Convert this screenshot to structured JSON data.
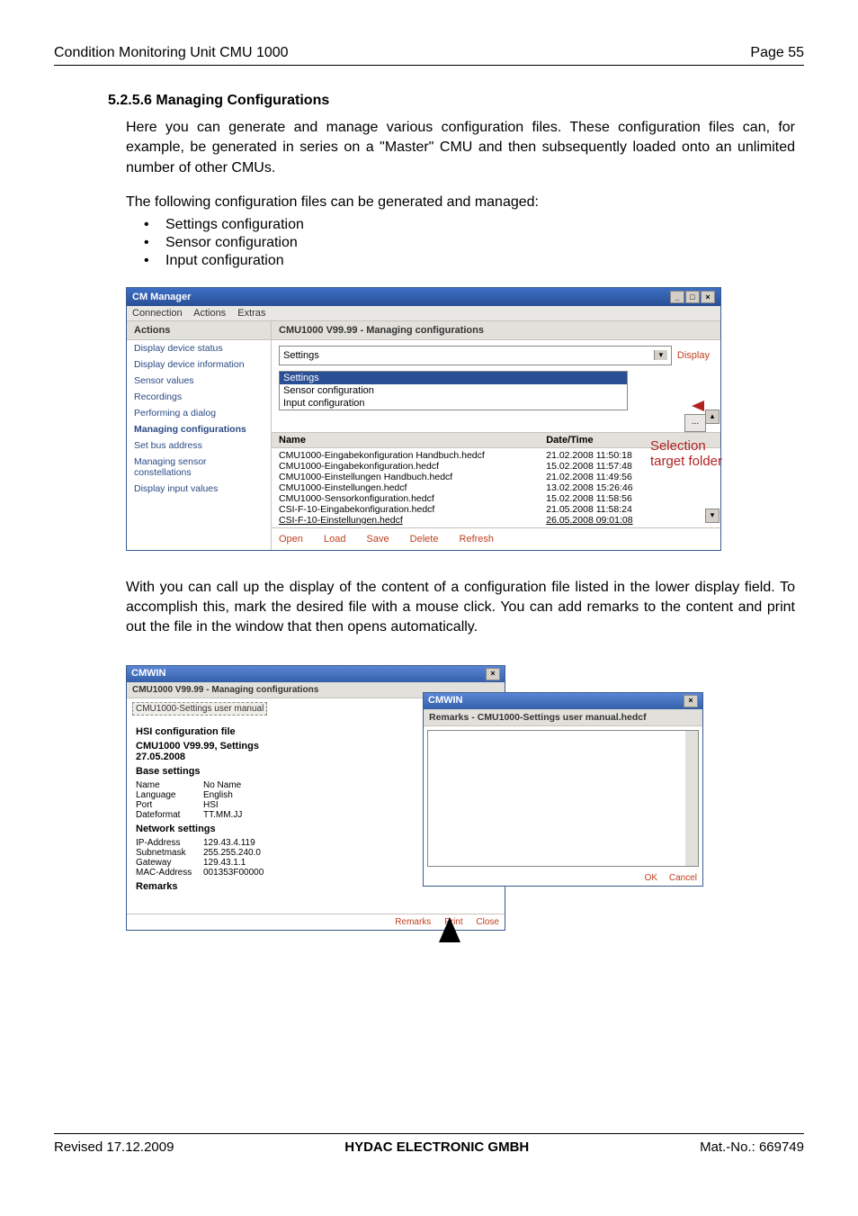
{
  "header": {
    "left": "Condition Monitoring Unit CMU 1000",
    "right": "Page 55"
  },
  "section": {
    "number_title": "5.2.5.6  Managing Configurations",
    "para1": "Here you can generate and manage various configuration files. These configuration files can, for example, be generated in series on a \"Master\" CMU and then subsequently loaded onto an unlimited number of other CMUs.",
    "para2": "The following configuration files can be generated and managed:",
    "bullets": [
      "Settings configuration",
      "Sensor configuration",
      "Input configuration"
    ]
  },
  "cm": {
    "title": "CM Manager",
    "menu": [
      "Connection",
      "Actions",
      "Extras"
    ],
    "side_head": "Actions",
    "side_items": [
      {
        "label": "Display device status",
        "bold": false
      },
      {
        "label": "Display device information",
        "bold": false
      },
      {
        "label": "Sensor values",
        "bold": false
      },
      {
        "label": "Recordings",
        "bold": false
      },
      {
        "label": "Performing a dialog",
        "bold": false
      },
      {
        "label": "Managing configurations",
        "bold": true
      },
      {
        "label": "Set bus address",
        "bold": false
      },
      {
        "label": "Managing sensor constellations",
        "bold": false
      },
      {
        "label": "Display input values",
        "bold": false
      }
    ],
    "main_head": "CMU1000 V99.99 - Managing configurations",
    "dropdown_value": "Settings",
    "display_btn": "Display",
    "dropdown_items": [
      "Settings",
      "Settings",
      "Sensor configuration",
      "Input configuration"
    ],
    "browse": "...",
    "col_name": "Name",
    "col_date": "Date/Time",
    "files": [
      {
        "name": "CMU1000-Eingabekonfiguration Handbuch.hedcf",
        "dt": "21.02.2008 11:50:18"
      },
      {
        "name": "CMU1000-Eingabekonfiguration.hedcf",
        "dt": "15.02.2008 11:57:48"
      },
      {
        "name": "CMU1000-Einstellungen Handbuch.hedcf",
        "dt": "21.02.2008 11:49:56"
      },
      {
        "name": "CMU1000-Einstellungen.hedcf",
        "dt": "13.02.2008 15:26:46"
      },
      {
        "name": "CMU1000-Sensorkonfiguration.hedcf",
        "dt": "15.02.2008 11:58:56"
      },
      {
        "name": "CSI-F-10-Eingabekonfiguration.hedcf",
        "dt": "21.05.2008 11:58:24"
      },
      {
        "name": "CSI-F-10-Einstellungen.hedcf",
        "dt": "26.05.2008 09:01:08"
      }
    ],
    "actions": [
      "Open",
      "Load",
      "Save",
      "Delete",
      "Refresh"
    ],
    "annot1": "Selection",
    "annot2": "target folder"
  },
  "para3": "With          you can call up the display of the content of a configuration file listed in the lower display field. To accomplish this, mark the desired file with a mouse click. You can add remarks to the content and print out the file in the window that then opens automatically.",
  "cmwin1": {
    "title": "CMWIN",
    "header": "CMU1000 V99.99 - Managing configurations",
    "tab": "CMU1000-Settings user manual",
    "h1": "HSI configuration file",
    "h2a": "CMU1000 V99.99, Settings",
    "h2b": "27.05.2008",
    "base": "Base settings",
    "base_kv": [
      {
        "k": "Name",
        "v": "No Name"
      },
      {
        "k": "Language",
        "v": "English"
      },
      {
        "k": "Port",
        "v": "HSI"
      },
      {
        "k": "Dateformat",
        "v": "TT.MM.JJ"
      }
    ],
    "net": "Network settings",
    "net_kv": [
      {
        "k": "IP-Address",
        "v": "129.43.4.119"
      },
      {
        "k": "Subnetmask",
        "v": "255.255.240.0"
      },
      {
        "k": "Gateway",
        "v": "129.43.1.1"
      },
      {
        "k": "MAC-Address",
        "v": "001353F00000"
      }
    ],
    "remarks": "Remarks",
    "btns": [
      "Remarks",
      "Print",
      "Close"
    ]
  },
  "cmwin2": {
    "title": "CMWIN",
    "header": "Remarks - CMU1000-Settings user manual.hedcf",
    "btns": [
      "OK",
      "Cancel"
    ]
  },
  "footer": {
    "left": "Revised 17.12.2009",
    "mid": "HYDAC ELECTRONIC GMBH",
    "right": "Mat.-No.: 669749"
  }
}
